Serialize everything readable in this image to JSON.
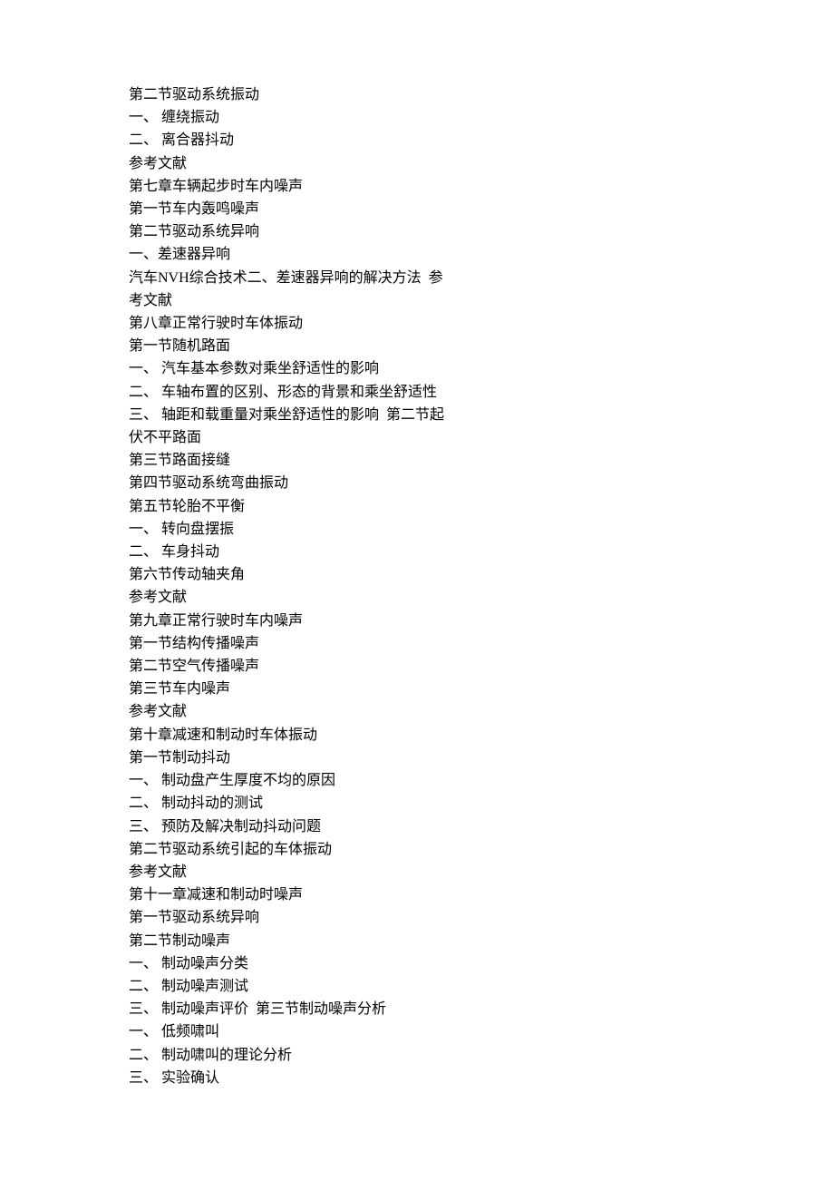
{
  "lines": [
    "第二节驱动系统振动",
    "一、 缠绕振动",
    "二、 离合器抖动",
    "参考文献",
    "第七章车辆起步时车内噪声",
    "第一节车内轰鸣噪声",
    "第二节驱动系统异响",
    "一、差速器异响",
    "汽车NVH综合技术二、差速器异响的解决方法  参",
    "考文献",
    "第八章正常行驶时车体振动",
    "第一节随机路面",
    "一、 汽车基本参数对乘坐舒适性的影响",
    "二、 车轴布置的区别、形态的背景和乘坐舒适性",
    "三、 轴距和载重量对乘坐舒适性的影响  第二节起",
    "伏不平路面",
    "第三节路面接缝",
    "第四节驱动系统弯曲振动",
    "第五节轮胎不平衡",
    "一、 转向盘摆振",
    "二、 车身抖动",
    "第六节传动轴夹角",
    "参考文献",
    "第九章正常行驶时车内噪声",
    "第一节结构传播噪声",
    "第二节空气传播噪声",
    "第三节车内噪声",
    "参考文献",
    "第十章减速和制动时车体振动",
    "第一节制动抖动",
    "一、 制动盘产生厚度不均的原因",
    "二、 制动抖动的测试",
    "三、 预防及解决制动抖动问题",
    "第二节驱动系统引起的车体振动",
    "参考文献",
    "第十一章减速和制动时噪声",
    "第一节驱动系统异响",
    "第二节制动噪声",
    "一、 制动噪声分类",
    "二、 制动噪声测试",
    "三、 制动噪声评价  第三节制动噪声分析",
    "一、 低频啸叫",
    "二、 制动啸叫的理论分析",
    "三、 实验确认"
  ]
}
